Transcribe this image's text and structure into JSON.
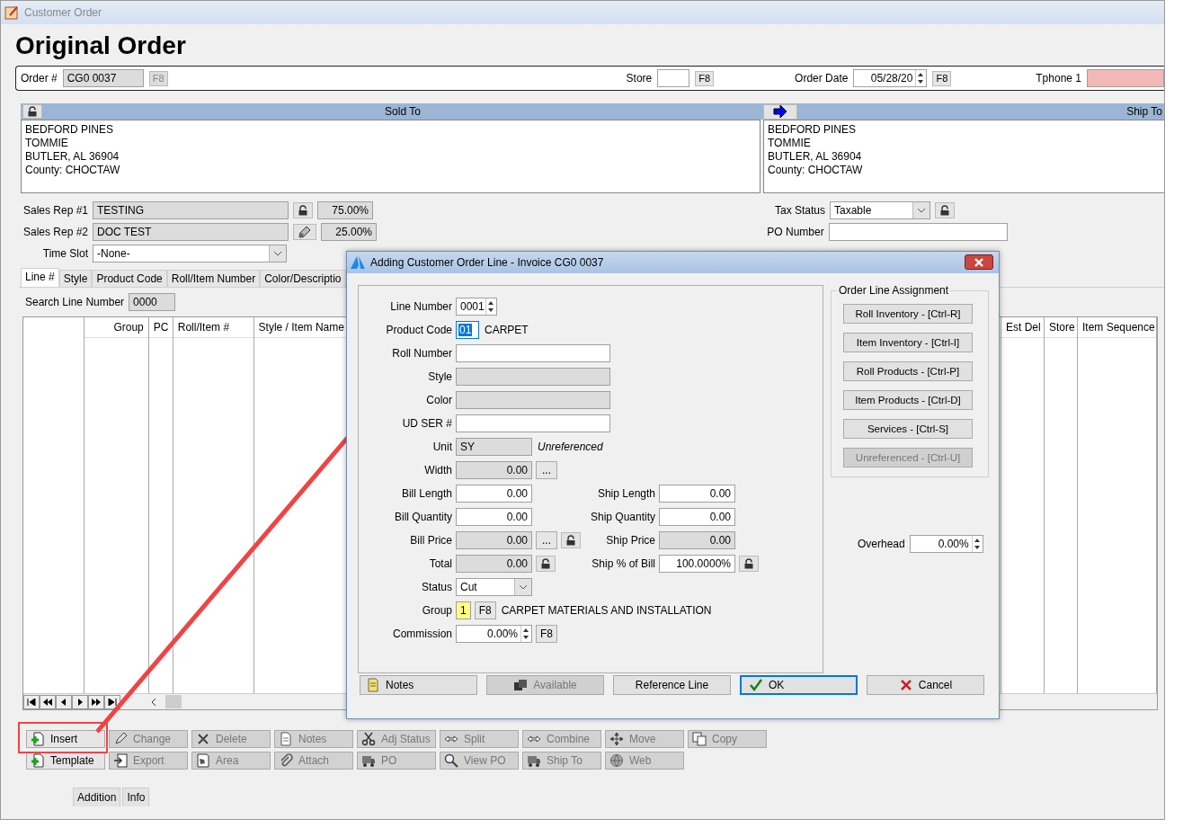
{
  "window": {
    "title": "Customer Order"
  },
  "heading": "Original Order",
  "order_bar": {
    "order_number": {
      "label": "Order #",
      "value": "CG0 0037",
      "key": {
        "label": "F8",
        "disabled": true
      }
    },
    "store": {
      "label": "Store",
      "key": {
        "label": "F8",
        "disabled": false
      }
    },
    "order_date": {
      "label": "Order Date",
      "value": "05/28/20",
      "key": {
        "label": "F8",
        "disabled": false
      }
    },
    "phone": {
      "label": "Tphone 1",
      "required": true
    }
  },
  "sold_to": {
    "title": "Sold To",
    "lines": [
      "BEDFORD PINES",
      "TOMMIE",
      "BUTLER, AL  36904",
      "County: CHOCTAW"
    ]
  },
  "ship_to": {
    "title": "Ship To",
    "lines": [
      "BEDFORD PINES",
      "TOMMIE",
      "BUTLER, AL  36904",
      "County: CHOCTAW"
    ]
  },
  "sales_reps": [
    {
      "label": "Sales Rep #1",
      "value": "TESTING",
      "share": "75.00%"
    },
    {
      "label": "Sales Rep #2",
      "value": "DOC TEST",
      "share": "25.00%"
    }
  ],
  "time_slot": {
    "label": "Time Slot",
    "value": "-None-"
  },
  "tax_status": {
    "label": "Tax Status",
    "value": "Taxable"
  },
  "po_number": {
    "label": "PO Number"
  },
  "tabs": [
    {
      "label": "Line #",
      "selected": true
    },
    {
      "label": "Style",
      "selected": false
    },
    {
      "label": "Product Code",
      "selected": false
    },
    {
      "label": "Roll/Item Number",
      "selected": false
    },
    {
      "label": "Color/Descriptio",
      "selected": false
    }
  ],
  "search": {
    "label": "Search Line Number",
    "value": "0000"
  },
  "grid": {
    "columns": [
      "Group",
      "PC",
      "Roll/Item #",
      "Style / Item Name",
      "Est Del",
      "Store",
      "Item Sequence"
    ]
  },
  "toolbar_rows": [
    {
      "buttons": [
        {
          "label": "Insert",
          "disabled": false
        },
        {
          "label": "Change",
          "disabled": true
        },
        {
          "label": "Delete",
          "disabled": true
        },
        {
          "label": "Notes",
          "disabled": true
        },
        {
          "label": "Adj Status",
          "disabled": true
        },
        {
          "label": "Split",
          "disabled": true
        },
        {
          "label": "Combine",
          "disabled": true
        },
        {
          "label": "Move",
          "disabled": true
        },
        {
          "label": "Copy",
          "disabled": true
        }
      ]
    },
    {
      "buttons": [
        {
          "label": "Template",
          "disabled": false
        },
        {
          "label": "Export",
          "disabled": true
        },
        {
          "label": "Area",
          "disabled": true
        },
        {
          "label": "Attach",
          "disabled": true
        },
        {
          "label": "PO",
          "disabled": true
        },
        {
          "label": "View PO",
          "disabled": true
        },
        {
          "label": "Ship To",
          "disabled": true
        },
        {
          "label": "Web",
          "disabled": true
        }
      ]
    }
  ],
  "bottom_tabs": [
    {
      "label": "Addition"
    },
    {
      "label": "Info"
    }
  ],
  "dialog": {
    "title": "Adding Customer Order Line - Invoice CG0 0037",
    "rows": [
      {
        "left": {
          "label": "Line Number",
          "kind": "spin",
          "value": "0001"
        }
      },
      {
        "left": {
          "label": "Product Code",
          "kind": "code",
          "value": "01",
          "extras": [
            {
              "kind": "note",
              "text": "CARPET"
            }
          ]
        }
      },
      {
        "left": {
          "label": "Roll Number",
          "kind": "input",
          "readonly": false
        }
      },
      {
        "left": {
          "label": "Style",
          "kind": "input",
          "readonly": true
        }
      },
      {
        "left": {
          "label": "Color",
          "kind": "input",
          "readonly": true
        }
      },
      {
        "left": {
          "label": "UD SER #",
          "kind": "input",
          "readonly": false
        }
      },
      {
        "left": {
          "label": "Unit",
          "kind": "input",
          "value": "SY",
          "readonly": true,
          "extras": [
            {
              "kind": "note",
              "text": "Unreferenced",
              "italic": true
            }
          ]
        }
      },
      {
        "left": {
          "label": "Width",
          "kind": "number",
          "value": "0.00",
          "readonly": true,
          "extras": [
            {
              "kind": "button",
              "label": "..."
            }
          ]
        }
      },
      {
        "left": {
          "label": "Bill Length",
          "kind": "number",
          "value": "0.00",
          "readonly": false
        },
        "right": {
          "label": "Ship Length",
          "kind": "number",
          "value": "0.00",
          "readonly": false
        }
      },
      {
        "left": {
          "label": "Bill Quantity",
          "kind": "number",
          "value": "0.00",
          "readonly": false
        },
        "right": {
          "label": "Ship Quantity",
          "kind": "number",
          "value": "0.00",
          "readonly": false
        }
      },
      {
        "left": {
          "label": "Bill Price",
          "kind": "number",
          "value": "0.00",
          "readonly": true,
          "extras": [
            {
              "kind": "button",
              "label": "..."
            },
            {
              "kind": "lock"
            }
          ]
        },
        "right": {
          "label": "Ship Price",
          "kind": "number",
          "value": "0.00",
          "readonly": true
        }
      },
      {
        "left": {
          "label": "Total",
          "kind": "number",
          "value": "0.00",
          "readonly": true,
          "extras": [
            {
              "kind": "lock"
            }
          ]
        },
        "right": {
          "label": "Ship % of Bill",
          "kind": "number",
          "value": "100.0000%",
          "readonly": false,
          "extras": [
            {
              "kind": "lock"
            }
          ]
        }
      },
      {
        "left": {
          "label": "Status",
          "kind": "select",
          "value": "Cut"
        }
      },
      {
        "left": {
          "label": "Group",
          "kind": "number",
          "value": "1",
          "highlighted": true,
          "extras": [
            {
              "kind": "button",
              "label": "F8"
            },
            {
              "kind": "note",
              "text": "CARPET MATERIALS AND INSTALLATION"
            }
          ]
        }
      },
      {
        "left": {
          "label": "Commission",
          "kind": "spin-number",
          "value": "0.00%",
          "extras": [
            {
              "kind": "button",
              "label": "F8"
            }
          ]
        }
      }
    ],
    "assignment": {
      "title": "Order Line Assignment",
      "buttons": [
        {
          "label": "Roll Inventory - [Ctrl-R]",
          "disabled": false
        },
        {
          "label": "Item Inventory - [Ctrl-I]",
          "disabled": false
        },
        {
          "label": "Roll Products - [Ctrl-P]",
          "disabled": false
        },
        {
          "label": "Item Products - [Ctrl-D]",
          "disabled": false
        },
        {
          "label": "Services - [Ctrl-S]",
          "disabled": false
        },
        {
          "label": "Unreferenced - [Ctrl-U]",
          "disabled": true
        }
      ]
    },
    "overhead": {
      "label": "Overhead",
      "value": "0.00%"
    },
    "buttons": [
      {
        "label": "Notes",
        "disabled": false,
        "default": false
      },
      {
        "label": "Available",
        "disabled": true,
        "default": false
      },
      {
        "label": "Reference Line",
        "disabled": false,
        "default": false
      },
      {
        "label": "OK",
        "disabled": false,
        "default": true
      },
      {
        "label": "Cancel",
        "disabled": false,
        "default": false
      }
    ]
  }
}
